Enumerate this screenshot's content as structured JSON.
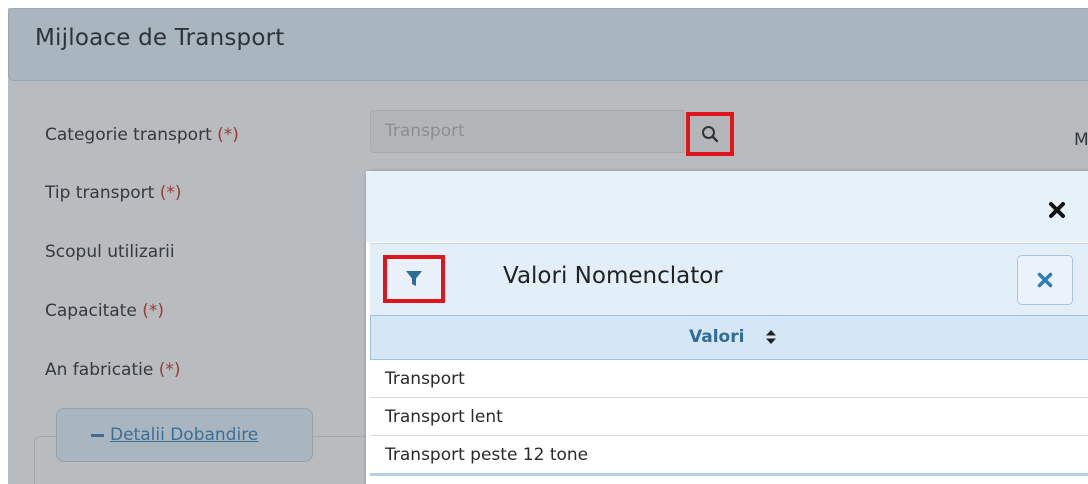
{
  "panel": {
    "title": "Mijloace de Transport"
  },
  "form": {
    "required_mark": "(*)",
    "fields": [
      {
        "label": "Categorie transport",
        "required": true
      },
      {
        "label": "Tip transport",
        "required": true
      },
      {
        "label": "Scopul utilizarii",
        "required": false
      },
      {
        "label": "Capacitate",
        "required": true
      },
      {
        "label": "An fabricatie",
        "required": true
      }
    ],
    "categorie_value": "Transport",
    "cut_label": "M",
    "details_button": "Detalii Dobandire"
  },
  "modal": {
    "title": "Valori Nomenclator",
    "column_header": "Valori",
    "rows": [
      "Transport",
      "Transport lent",
      "Transport peste 12 tone"
    ]
  },
  "icons": {
    "search": "search-icon",
    "close": "close-icon",
    "filter": "filter-icon",
    "clear": "clear-icon",
    "sort": "sort-icon"
  },
  "colors": {
    "highlight": "#e0141b",
    "accent": "#2f6c9a",
    "required": "#9a3a3a"
  }
}
